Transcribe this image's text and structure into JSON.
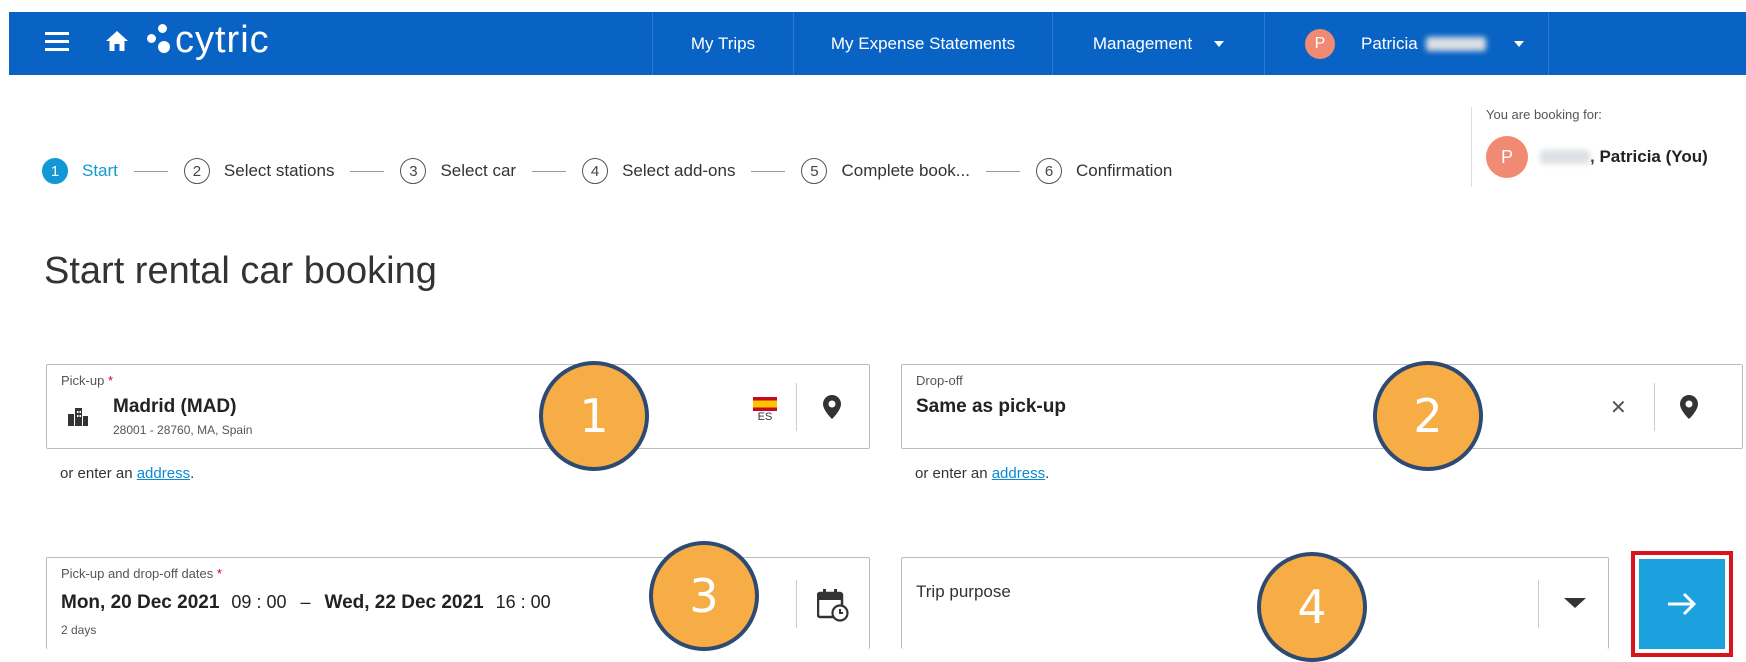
{
  "header": {
    "brand": "cytric",
    "nav": {
      "my_trips": "My Trips",
      "my_expense_statements": "My Expense Statements",
      "management": "Management",
      "user_initial": "P",
      "user_name": "Patricia"
    }
  },
  "stepper": {
    "steps": [
      {
        "num": "1",
        "label": "Start"
      },
      {
        "num": "2",
        "label": "Select stations"
      },
      {
        "num": "3",
        "label": "Select car"
      },
      {
        "num": "4",
        "label": "Select add-ons"
      },
      {
        "num": "5",
        "label": "Complete book..."
      },
      {
        "num": "6",
        "label": "Confirmation"
      }
    ],
    "active_step": 1
  },
  "booking_for": {
    "caption": "You are booking for:",
    "initial": "P",
    "name": ", Patricia (You)"
  },
  "page_title": "Start rental car booking",
  "pickup": {
    "label": "Pick-up",
    "required_mark": "*",
    "value": "Madrid (MAD)",
    "detail": "28001 - 28760, MA, Spain",
    "country_code": "ES",
    "helper_prefix": "or enter an ",
    "helper_link": "address",
    "helper_suffix": "."
  },
  "dropoff": {
    "label": "Drop-off",
    "value": "Same as pick-up",
    "clear_glyph": "✕",
    "helper_prefix": "or enter an ",
    "helper_link": "address",
    "helper_suffix": "."
  },
  "dates": {
    "label": "Pick-up and drop-off dates",
    "required_mark": "*",
    "start_date": "Mon, 20 Dec 2021",
    "start_time": "09 : 00",
    "dash": "–",
    "end_date": "Wed, 22 Dec 2021",
    "end_time": "16 : 00",
    "duration": "2 days"
  },
  "trip_purpose": {
    "placeholder": "Trip purpose"
  },
  "annotations": [
    "1",
    "2",
    "3",
    "4"
  ],
  "colors": {
    "header_bg": "#0963c4",
    "accent": "#1498d5",
    "avatar": "#f08a72",
    "annotation_fill": "#f6ad45",
    "annotation_border": "#2f4a72",
    "highlight": "#d9141f"
  }
}
